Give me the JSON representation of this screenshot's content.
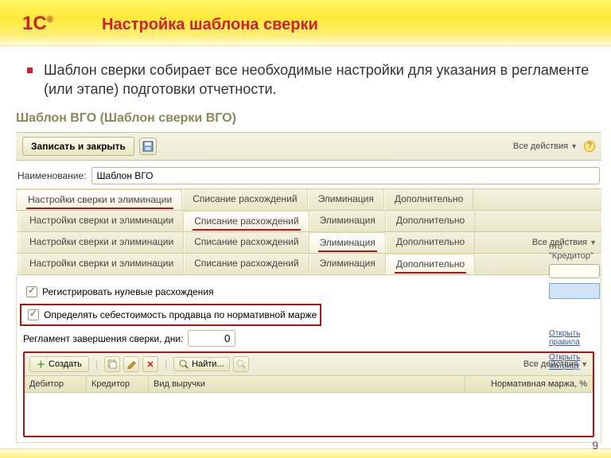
{
  "slide": {
    "title": "Настройка шаблона сверки",
    "bullet": "Шаблон сверки собирает все необходимые настройки для указания в регламенте (или этапе) подготовки отчетности.",
    "page_number": "9",
    "logo_text": "1C"
  },
  "form": {
    "window_title": "Шаблон ВГО (Шаблон сверки ВГО)",
    "save_close_label": "Записать и закрыть",
    "all_actions_label": "Все действия",
    "name_label": "Наименование:",
    "name_value": "Шаблон ВГО"
  },
  "tabs": {
    "t1": "Настройки сверки и элиминации",
    "t2": "Списание расхождений",
    "t3": "Элиминация",
    "t4": "Дополнительно"
  },
  "extra": {
    "chk_zero": "Регистрировать нулевые расхождения",
    "chk_cost": "Определять себестоимость продавца по нормативной марже",
    "reglament_label": "Регламент завершения сверки, дни:",
    "reglament_value": "0",
    "peek_creditor": "нто \"Кредитор\"",
    "link_rules": "Открыть правила",
    "link_matrix": "Открыть матрицу"
  },
  "grid": {
    "create_label": "Создать",
    "find_label": "Найти...",
    "all_actions_label": "Все действия",
    "col_debtor": "Дебитор",
    "col_creditor": "Кредитор",
    "col_revenue": "Вид выручки",
    "col_margin": "Нормативная маржа, %"
  }
}
